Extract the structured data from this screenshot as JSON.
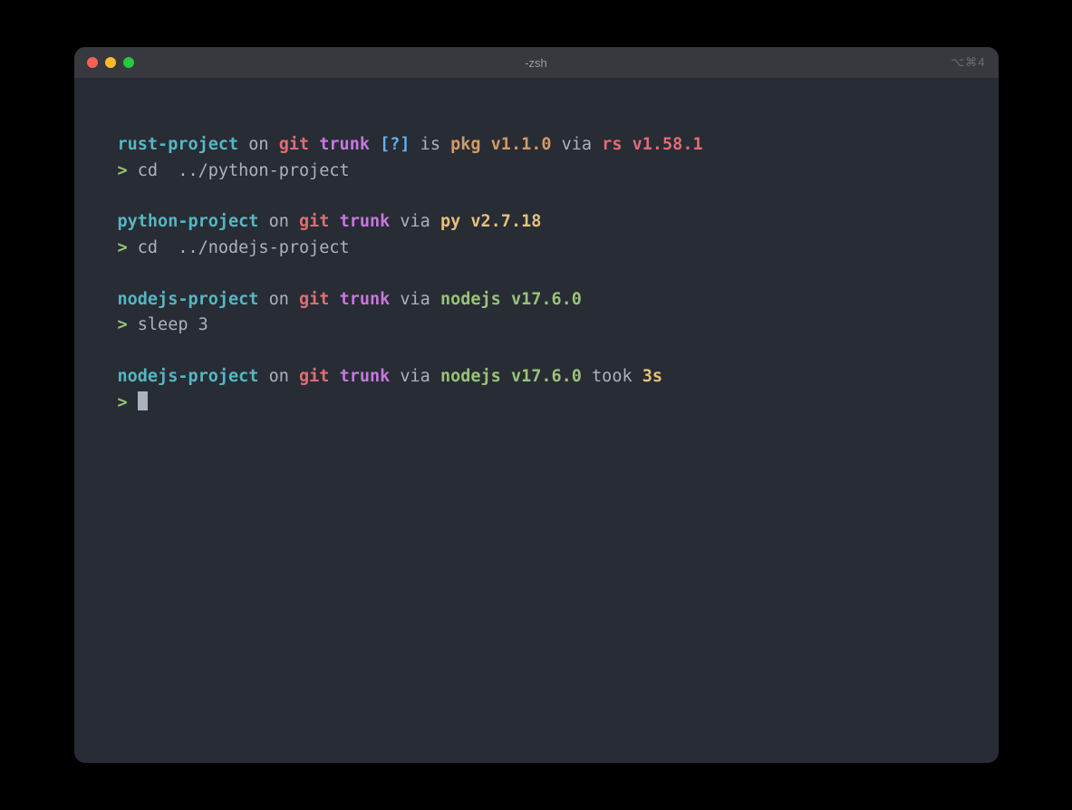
{
  "window": {
    "title": "-zsh",
    "shortcut": "⌥⌘4"
  },
  "blocks": [
    {
      "prompt_segments": [
        {
          "text": "rust-project",
          "class": "cyan"
        },
        {
          "text": " on ",
          "class": "white"
        },
        {
          "text": "git",
          "class": "red"
        },
        {
          "text": " ",
          "class": "white"
        },
        {
          "text": "trunk",
          "class": "magenta"
        },
        {
          "text": " [?]",
          "class": "blue"
        },
        {
          "text": " is ",
          "class": "white"
        },
        {
          "text": "pkg",
          "class": "orange"
        },
        {
          "text": " ",
          "class": "white"
        },
        {
          "text": "v1.1.0",
          "class": "orange"
        },
        {
          "text": " via ",
          "class": "white"
        },
        {
          "text": "rs",
          "class": "red"
        },
        {
          "text": " ",
          "class": "white"
        },
        {
          "text": "v1.58.1",
          "class": "red"
        }
      ],
      "command": "cd  ../python-project"
    },
    {
      "prompt_segments": [
        {
          "text": "python-project",
          "class": "cyan"
        },
        {
          "text": " on ",
          "class": "white"
        },
        {
          "text": "git",
          "class": "red"
        },
        {
          "text": " ",
          "class": "white"
        },
        {
          "text": "trunk",
          "class": "magenta"
        },
        {
          "text": " via ",
          "class": "white"
        },
        {
          "text": "py",
          "class": "yellow"
        },
        {
          "text": " ",
          "class": "white"
        },
        {
          "text": "v2.7.18",
          "class": "yellow"
        }
      ],
      "command": "cd  ../nodejs-project"
    },
    {
      "prompt_segments": [
        {
          "text": "nodejs-project",
          "class": "cyan"
        },
        {
          "text": " on ",
          "class": "white"
        },
        {
          "text": "git",
          "class": "red"
        },
        {
          "text": " ",
          "class": "white"
        },
        {
          "text": "trunk",
          "class": "magenta"
        },
        {
          "text": " via ",
          "class": "white"
        },
        {
          "text": "nodejs",
          "class": "green"
        },
        {
          "text": " ",
          "class": "white"
        },
        {
          "text": "v17.6.0",
          "class": "green"
        }
      ],
      "command": "sleep 3"
    },
    {
      "prompt_segments": [
        {
          "text": "nodejs-project",
          "class": "cyan"
        },
        {
          "text": " on ",
          "class": "white"
        },
        {
          "text": "git",
          "class": "red"
        },
        {
          "text": " ",
          "class": "white"
        },
        {
          "text": "trunk",
          "class": "magenta"
        },
        {
          "text": " via ",
          "class": "white"
        },
        {
          "text": "nodejs",
          "class": "green"
        },
        {
          "text": " ",
          "class": "white"
        },
        {
          "text": "v17.6.0",
          "class": "green"
        },
        {
          "text": " took ",
          "class": "white"
        },
        {
          "text": "3s",
          "class": "yellow"
        }
      ],
      "command": null,
      "cursor": true
    }
  ],
  "prompt_symbol": ">"
}
